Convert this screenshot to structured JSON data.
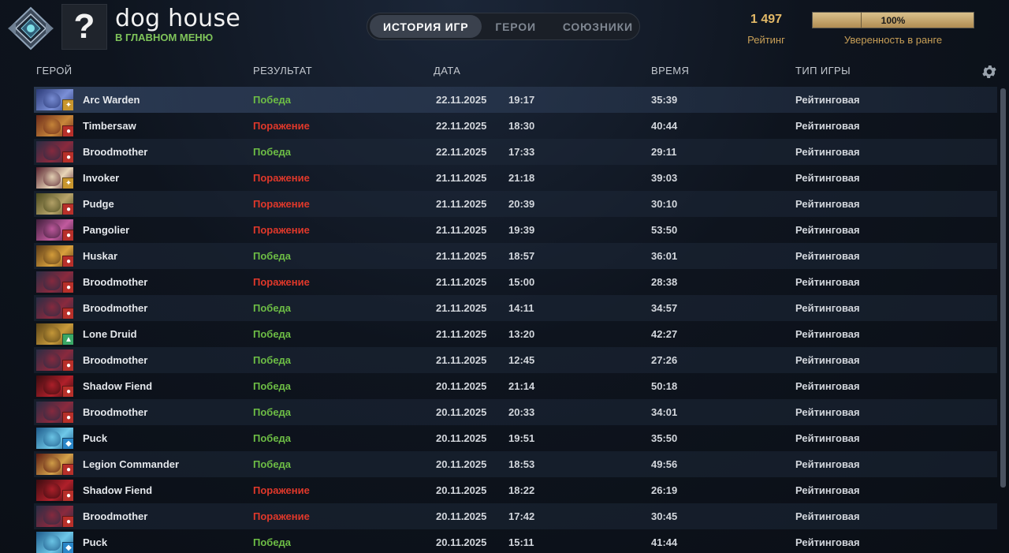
{
  "header": {
    "player_name": "dog house",
    "player_status": "В ГЛАВНОМ МЕНЮ",
    "avatar_glyph": "?",
    "tabs": [
      {
        "label": "ИСТОРИЯ ИГР",
        "active": true
      },
      {
        "label": "ГЕРОИ",
        "active": false
      },
      {
        "label": "СОЮЗНИКИ",
        "active": false
      }
    ],
    "rating_value": "1 497",
    "rating_label": "Рейтинг",
    "confidence_value": "100%",
    "confidence_fraction": 1.0,
    "confidence_label": "Уверенность в ранге"
  },
  "columns": {
    "hero": "ГЕРОЙ",
    "result": "РЕЗУЛЬТАТ",
    "date": "ДАТА",
    "duration": "ВРЕМЯ",
    "game_type": "ТИП ИГРЫ"
  },
  "colors": {
    "win": "#6dbd45",
    "loss": "#e0382a",
    "accent_gold": "#e3b967"
  },
  "matches": [
    {
      "hero": "Arc Warden",
      "result": "Победа",
      "win": true,
      "date": "22.11.2025",
      "time": "19:17",
      "duration": "35:39",
      "type": "Рейтинговая",
      "portrait": [
        "#2b3a78",
        "#7a8fd6"
      ],
      "attr": "universal"
    },
    {
      "hero": "Timbersaw",
      "result": "Поражение",
      "win": false,
      "date": "22.11.2025",
      "time": "18:30",
      "duration": "40:44",
      "type": "Рейтинговая",
      "portrait": [
        "#6b2a1a",
        "#c8873a"
      ],
      "attr": "strength"
    },
    {
      "hero": "Broodmother",
      "result": "Победа",
      "win": true,
      "date": "22.11.2025",
      "time": "17:33",
      "duration": "29:11",
      "type": "Рейтинговая",
      "portrait": [
        "#2a2c44",
        "#8a2a3e"
      ],
      "attr": "strength"
    },
    {
      "hero": "Invoker",
      "result": "Поражение",
      "win": false,
      "date": "21.11.2025",
      "time": "21:18",
      "duration": "39:03",
      "type": "Рейтинговая",
      "portrait": [
        "#5a2430",
        "#e8d6b8"
      ],
      "attr": "universal"
    },
    {
      "hero": "Pudge",
      "result": "Поражение",
      "win": false,
      "date": "21.11.2025",
      "time": "20:39",
      "duration": "30:10",
      "type": "Рейтинговая",
      "portrait": [
        "#4a4a1e",
        "#b7a46a"
      ],
      "attr": "strength"
    },
    {
      "hero": "Pangolier",
      "result": "Поражение",
      "win": false,
      "date": "21.11.2025",
      "time": "19:39",
      "duration": "53:50",
      "type": "Рейтинговая",
      "portrait": [
        "#3e1e3a",
        "#c15a9e"
      ],
      "attr": "strength"
    },
    {
      "hero": "Huskar",
      "result": "Победа",
      "win": true,
      "date": "21.11.2025",
      "time": "18:57",
      "duration": "36:01",
      "type": "Рейтинговая",
      "portrait": [
        "#5a3a18",
        "#d9a13c"
      ],
      "attr": "strength"
    },
    {
      "hero": "Broodmother",
      "result": "Поражение",
      "win": false,
      "date": "21.11.2025",
      "time": "15:00",
      "duration": "28:38",
      "type": "Рейтинговая",
      "portrait": [
        "#2a2c44",
        "#8a2a3e"
      ],
      "attr": "strength"
    },
    {
      "hero": "Broodmother",
      "result": "Победа",
      "win": true,
      "date": "21.11.2025",
      "time": "14:11",
      "duration": "34:57",
      "type": "Рейтинговая",
      "portrait": [
        "#2a2c44",
        "#8a2a3e"
      ],
      "attr": "strength"
    },
    {
      "hero": "Lone Druid",
      "result": "Победа",
      "win": true,
      "date": "21.11.2025",
      "time": "13:20",
      "duration": "42:27",
      "type": "Рейтинговая",
      "portrait": [
        "#5a4418",
        "#c89a3a"
      ],
      "attr": "agility"
    },
    {
      "hero": "Broodmother",
      "result": "Победа",
      "win": true,
      "date": "21.11.2025",
      "time": "12:45",
      "duration": "27:26",
      "type": "Рейтинговая",
      "portrait": [
        "#2a2c44",
        "#8a2a3e"
      ],
      "attr": "strength"
    },
    {
      "hero": "Shadow Fiend",
      "result": "Победа",
      "win": true,
      "date": "20.11.2025",
      "time": "21:14",
      "duration": "50:18",
      "type": "Рейтинговая",
      "portrait": [
        "#3a0c10",
        "#b0202a"
      ],
      "attr": "strength"
    },
    {
      "hero": "Broodmother",
      "result": "Победа",
      "win": true,
      "date": "20.11.2025",
      "time": "20:33",
      "duration": "34:01",
      "type": "Рейтинговая",
      "portrait": [
        "#2a2c44",
        "#8a2a3e"
      ],
      "attr": "strength"
    },
    {
      "hero": "Puck",
      "result": "Победа",
      "win": true,
      "date": "20.11.2025",
      "time": "19:51",
      "duration": "35:50",
      "type": "Рейтинговая",
      "portrait": [
        "#1e5a8a",
        "#6ec8e8"
      ],
      "attr": "intelligence"
    },
    {
      "hero": "Legion Commander",
      "result": "Победа",
      "win": true,
      "date": "20.11.2025",
      "time": "18:53",
      "duration": "49:56",
      "type": "Рейтинговая",
      "portrait": [
        "#5a1a12",
        "#d4a24a"
      ],
      "attr": "strength"
    },
    {
      "hero": "Shadow Fiend",
      "result": "Поражение",
      "win": false,
      "date": "20.11.2025",
      "time": "18:22",
      "duration": "26:19",
      "type": "Рейтинговая",
      "portrait": [
        "#3a0c10",
        "#b0202a"
      ],
      "attr": "strength"
    },
    {
      "hero": "Broodmother",
      "result": "Поражение",
      "win": false,
      "date": "20.11.2025",
      "time": "17:42",
      "duration": "30:45",
      "type": "Рейтинговая",
      "portrait": [
        "#2a2c44",
        "#8a2a3e"
      ],
      "attr": "strength"
    },
    {
      "hero": "Puck",
      "result": "Победа",
      "win": true,
      "date": "20.11.2025",
      "time": "15:11",
      "duration": "41:44",
      "type": "Рейтинговая",
      "portrait": [
        "#1e5a8a",
        "#6ec8e8"
      ],
      "attr": "intelligence"
    }
  ]
}
